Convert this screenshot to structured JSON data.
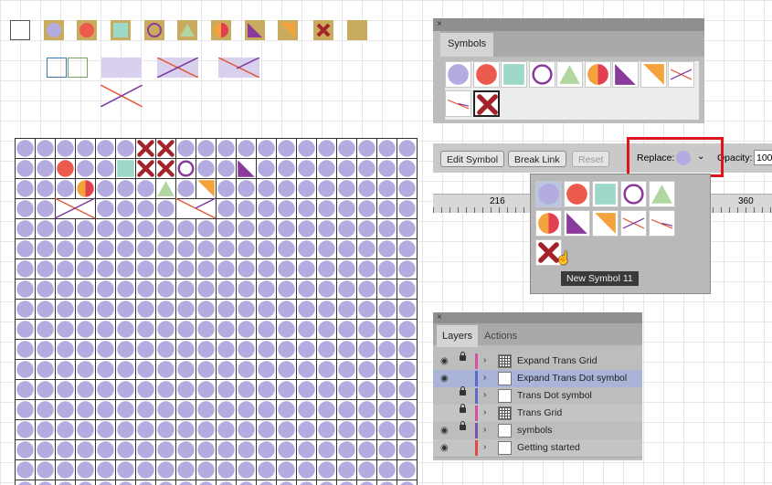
{
  "colors": {
    "lavender": "#b4ace0",
    "red": "#ec5a4e",
    "teal": "#9ed8c8",
    "purple": "#8a3a9a",
    "green": "#b2d6a0",
    "orange": "#f4a23c",
    "dark_red": "#a4232a",
    "gold": "#c9ab5f",
    "highlight_red": "#e0141e"
  },
  "symbols_panel": {
    "close": "×",
    "tab": "Symbols",
    "symbols": [
      "lavender-circle",
      "red-circle",
      "teal-square",
      "purple-ring",
      "green-triangle",
      "half-circle",
      "purple-triangle",
      "orange-triangle",
      "cross-lines",
      "thin-cross",
      "red-x"
    ]
  },
  "control_bar": {
    "edit_symbol": "Edit Symbol",
    "break_link": "Break Link",
    "reset": "Reset",
    "replace_label": "Replace:",
    "opacity_label": "Opacity:",
    "opacity_value": "100",
    "ruler_216": "216",
    "ruler_360": "360",
    "tooltip": "New Symbol 11"
  },
  "layers_panel": {
    "close": "×",
    "tab_layers": "Layers",
    "tab_actions": "Actions",
    "rows": [
      {
        "name": "Expand Trans Grid",
        "eye": true,
        "lock": true,
        "color": "#d94fa0"
      },
      {
        "name": "Expand Trans Dot symbol",
        "eye": true,
        "lock": false,
        "color": "#5a6ac8",
        "selected": true
      },
      {
        "name": "Trans Dot symbol",
        "eye": false,
        "lock": true,
        "color": "#5a6ac8"
      },
      {
        "name": "Trans Grid",
        "eye": false,
        "lock": true,
        "color": "#d94fa0"
      },
      {
        "name": "symbols",
        "eye": true,
        "lock": true,
        "color": "#7a50b0"
      },
      {
        "name": "Getting started",
        "eye": true,
        "lock": false,
        "color": "#e04a4a"
      }
    ]
  }
}
